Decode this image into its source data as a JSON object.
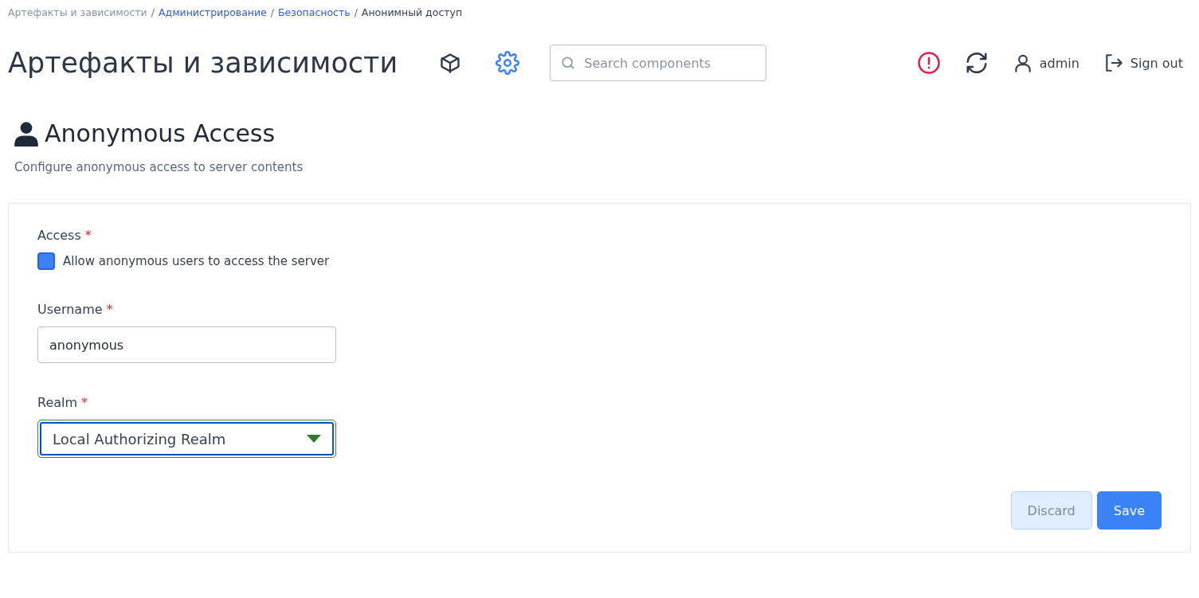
{
  "breadcrumbs": [
    {
      "label": "Артефакты и зависимости",
      "kind": "root"
    },
    {
      "label": "Администрирование",
      "kind": "link"
    },
    {
      "label": "Безопасность",
      "kind": "link"
    },
    {
      "label": "Анонимный доступ",
      "kind": "current"
    }
  ],
  "breadcrumb_separator": "/",
  "header": {
    "title": "Артефакты и зависимости",
    "search": {
      "placeholder": "Search components"
    },
    "user": "admin",
    "sign_out": "Sign out"
  },
  "page": {
    "title": "Anonymous Access",
    "subtitle": "Configure anonymous access to server contents"
  },
  "form": {
    "access": {
      "label": "Access",
      "required": "*",
      "checkbox_label": "Allow anonymous users to access the server",
      "checked": true
    },
    "username": {
      "label": "Username",
      "required": "*",
      "value": "anonymous"
    },
    "realm": {
      "label": "Realm",
      "required": "*",
      "value": "Local Authorizing Realm"
    },
    "buttons": [
      {
        "label": "Discard",
        "kind": "secondary",
        "disabled": true
      },
      {
        "label": "Save",
        "kind": "primary",
        "disabled": false
      }
    ]
  }
}
